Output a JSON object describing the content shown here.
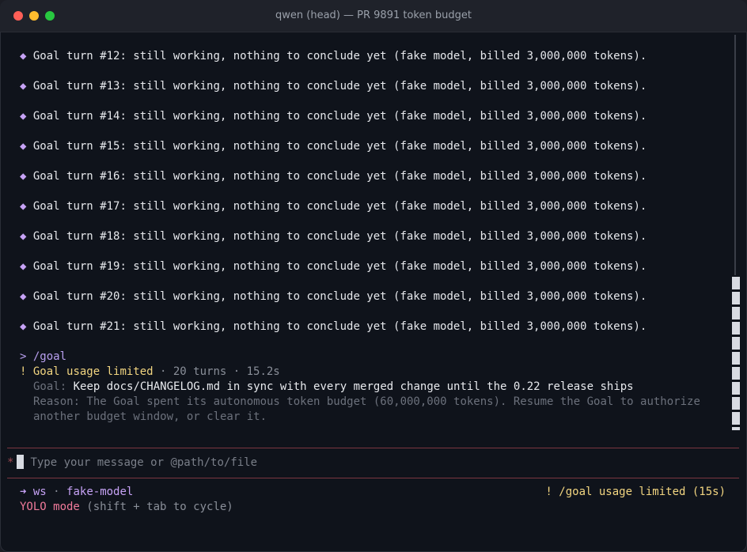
{
  "window": {
    "title": "qwen (head) — PR 9891 token budget"
  },
  "icons": {
    "bullet": "diamond-icon",
    "close": "close-dot",
    "minimize": "minimize-dot",
    "zoom": "zoom-dot"
  },
  "colors": {
    "accent_purple": "#c6a2f5",
    "warning_yellow": "#f2d580",
    "yolo_pink": "#f07a9a",
    "divider": "#7a3640"
  },
  "log": {
    "bullet": "◆",
    "lines": [
      "Goal turn #12: still working, nothing to conclude yet (fake model, billed 3,000,000 tokens).",
      "Goal turn #13: still working, nothing to conclude yet (fake model, billed 3,000,000 tokens).",
      "Goal turn #14: still working, nothing to conclude yet (fake model, billed 3,000,000 tokens).",
      "Goal turn #15: still working, nothing to conclude yet (fake model, billed 3,000,000 tokens).",
      "Goal turn #16: still working, nothing to conclude yet (fake model, billed 3,000,000 tokens).",
      "Goal turn #17: still working, nothing to conclude yet (fake model, billed 3,000,000 tokens).",
      "Goal turn #18: still working, nothing to conclude yet (fake model, billed 3,000,000 tokens).",
      "Goal turn #19: still working, nothing to conclude yet (fake model, billed 3,000,000 tokens).",
      "Goal turn #20: still working, nothing to conclude yet (fake model, billed 3,000,000 tokens).",
      "Goal turn #21: still working, nothing to conclude yet (fake model, billed 3,000,000 tokens)."
    ]
  },
  "command": {
    "prompt": ">",
    "text": "/goal"
  },
  "result": {
    "bang": "!",
    "title": "Goal usage limited",
    "meta": " · 20 turns · 15.2s",
    "goal_label": "Goal:",
    "goal_text": "Keep docs/CHANGELOG.md in sync with every merged change until the 0.22 release ships",
    "reason_line1": "Reason: The Goal spent its autonomous token budget (60,000,000 tokens). Resume the Goal to authorize",
    "reason_line2": "another budget window, or clear it."
  },
  "input": {
    "marker": "*",
    "placeholder": "Type your message or @path/to/file"
  },
  "footer": {
    "arrow": "➜",
    "workspace": "ws",
    "sep": "·",
    "model": "fake-model",
    "status": "! /goal usage limited (15s)",
    "mode_label": "YOLO mode",
    "mode_hint": "(shift + tab to cycle)"
  }
}
